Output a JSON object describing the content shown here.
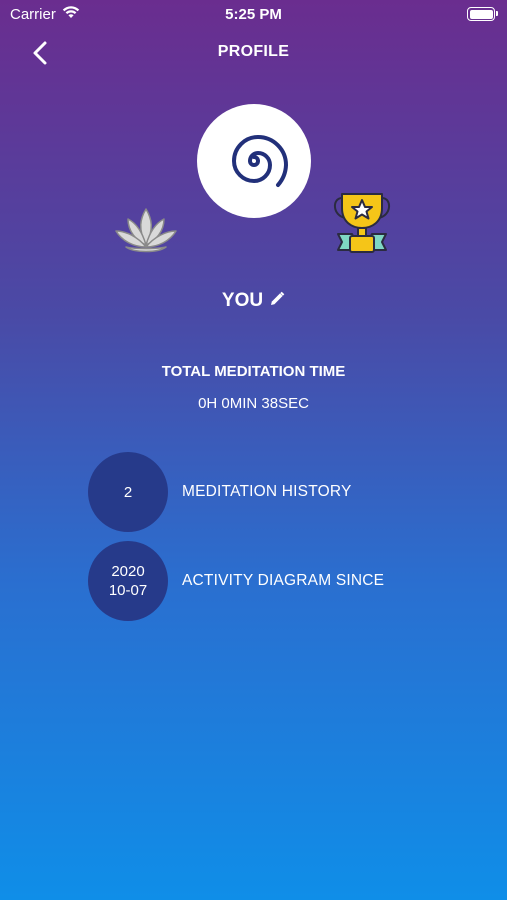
{
  "status_bar": {
    "carrier": "Carrier",
    "time": "5:25 PM"
  },
  "header": {
    "title": "PROFILE"
  },
  "profile": {
    "name": "YOU"
  },
  "stats": {
    "total_label": "TOTAL MEDITATION TIME",
    "total_value": "0H 0MIN 38SEC"
  },
  "rows": [
    {
      "value": "2",
      "label": "MEDITATION HISTORY"
    },
    {
      "value_line1": "2020",
      "value_line2": "10-07",
      "label": "ACTIVITY DIAGRAM SINCE"
    }
  ],
  "colors": {
    "gradient_top": "#6a2d8f",
    "gradient_bottom": "#0f8ee8",
    "circle": "#263a8a",
    "spiral": "#22307a"
  },
  "icons": [
    "back-icon",
    "spiral-icon",
    "lotus-icon",
    "trophy-icon",
    "pencil-icon",
    "wifi-icon",
    "battery-icon"
  ]
}
